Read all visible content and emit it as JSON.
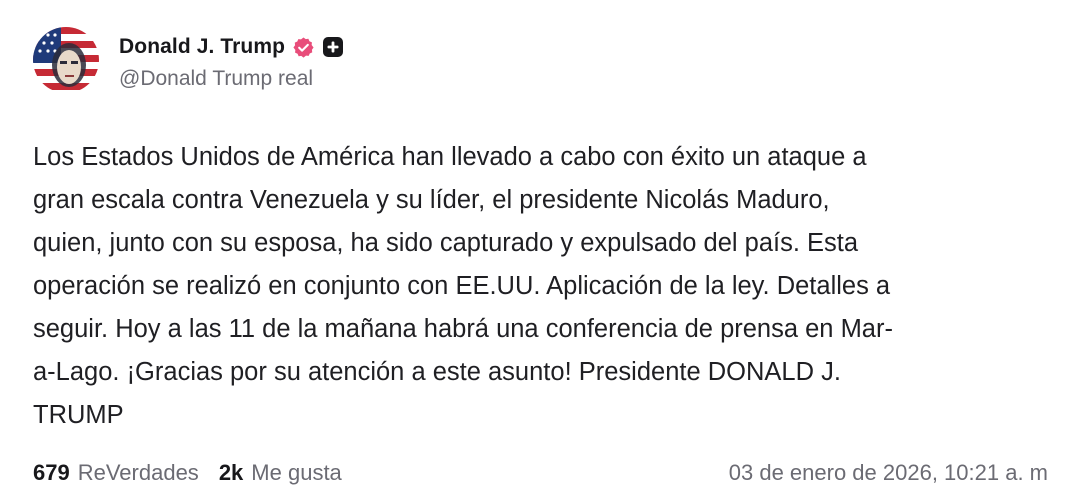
{
  "author": {
    "display_name": "Donald J. Trump",
    "handle": "@Donald Trump real",
    "verified_badge_color": "#e84d7a",
    "icons": [
      "verified-icon",
      "plus-icon"
    ]
  },
  "post": {
    "text": "Los Estados Unidos de América han llevado a cabo con éxito un ataque a\ngran escala contra Venezuela y su líder, el presidente Nicolás Maduro,\nquien, junto con su esposa, ha sido capturado y expulsado del país. Esta\noperación se realizó en conjunto con EE.UU. Aplicación de la ley. Detalles a\nseguir. Hoy a las 11 de la mañana habrá una conferencia de prensa en Mar-\na-Lago. ¡Gracias por su atención a este asunto! Presidente DONALD J.\nTRUMP"
  },
  "stats": {
    "reposts_count": "679",
    "reposts_label": "ReVerdades",
    "likes_count": "2k",
    "likes_label": "Me gusta"
  },
  "timestamp": "03 de enero de 2026, 10:21 a. m"
}
